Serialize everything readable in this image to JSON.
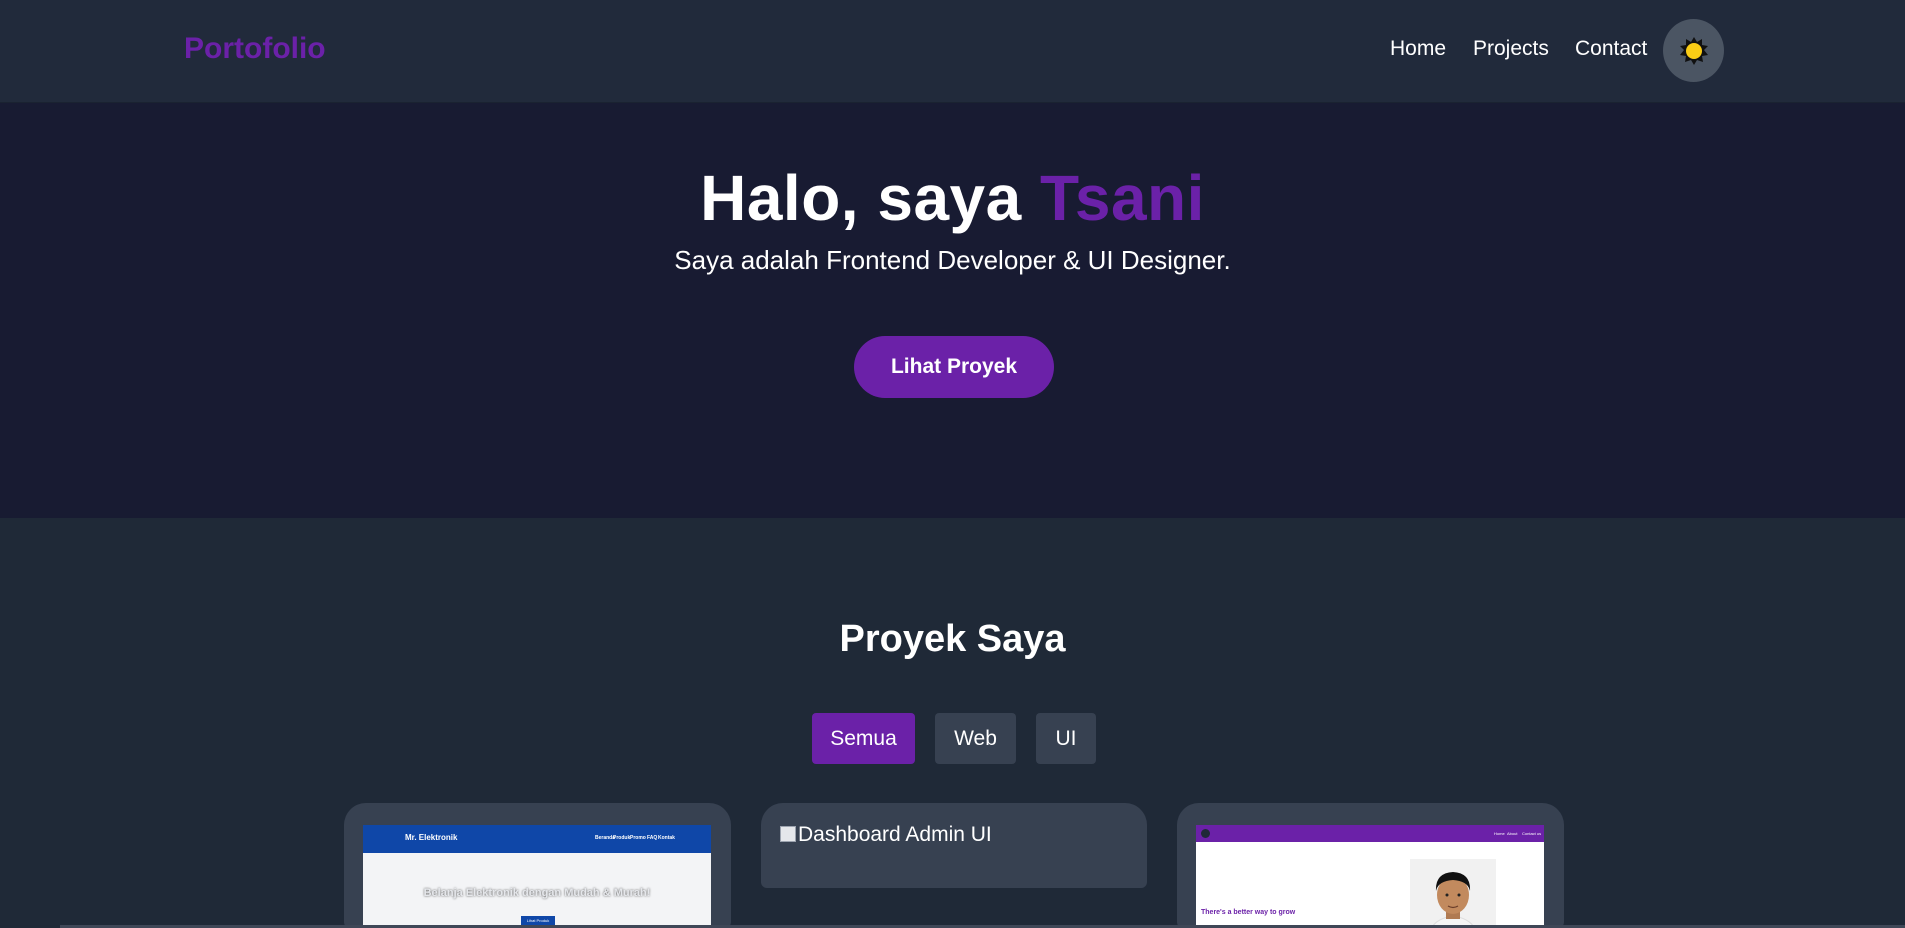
{
  "navbar": {
    "brand": "Portofolio",
    "links": [
      "Home",
      "Projects",
      "Contact"
    ],
    "theme_toggle_icon": "sun-icon"
  },
  "hero": {
    "title_prefix": "Halo, saya ",
    "title_name": "Tsani",
    "subtitle": "Saya adalah Frontend Developer & UI Designer.",
    "cta_label": "Lihat Proyek"
  },
  "projects": {
    "title": "Proyek Saya",
    "filters": [
      "Semua",
      "Web",
      "UI"
    ],
    "active_filter": "Semua",
    "cards": [
      {
        "thumb_brand": "Mr. Elektronik",
        "thumb_nav": [
          "Beranda",
          "Produk",
          "Promo",
          "FAQ",
          "Kontak"
        ],
        "thumb_headline": "Belanja Elektronik dengan Mudah & Murah!",
        "thumb_button": "Lihat Produk"
      },
      {
        "image_alt": "Dashboard Admin UI"
      },
      {
        "thumb_nav": [
          "Home",
          "About",
          "Contact us"
        ],
        "thumb_headline": "There's a better way to grow"
      }
    ]
  },
  "colors": {
    "accent": "#6b21a8",
    "nav_bg": "#212a3b",
    "hero_bg": "#181b32",
    "page_bg": "#1f2937",
    "card_bg": "#374151"
  }
}
